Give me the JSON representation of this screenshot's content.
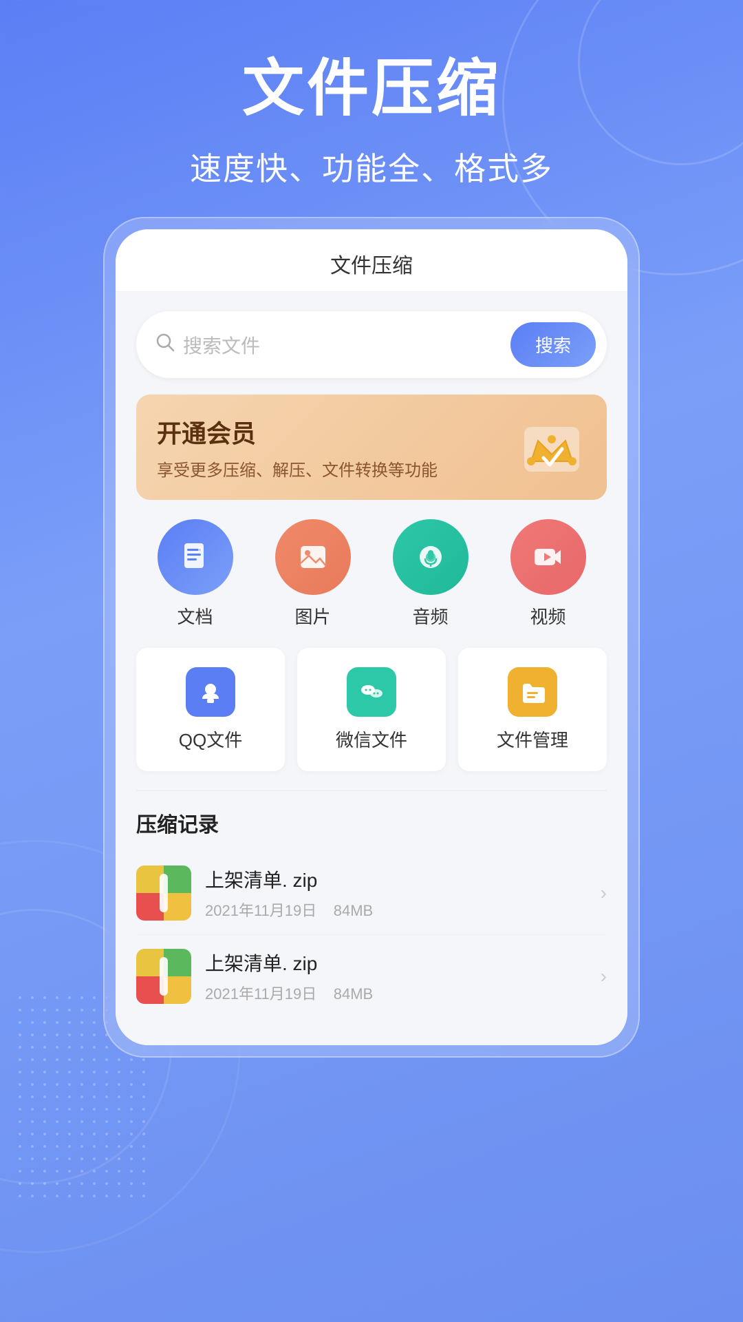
{
  "header": {
    "title": "文件压缩",
    "subtitle": "速度快、功能全、格式多"
  },
  "app": {
    "title": "文件压缩"
  },
  "search": {
    "placeholder": "搜索文件",
    "button_label": "搜索"
  },
  "vip": {
    "title": "开通会员",
    "desc": "享受更多压缩、解压、文件转换等功能"
  },
  "categories": [
    {
      "id": "doc",
      "label": "文档",
      "icon": "📄"
    },
    {
      "id": "img",
      "label": "图片",
      "icon": "🖼"
    },
    {
      "id": "audio",
      "label": "音频",
      "icon": "🎙"
    },
    {
      "id": "video",
      "label": "视频",
      "icon": "🎬"
    }
  ],
  "quick_access": [
    {
      "id": "qq",
      "label": "QQ文件",
      "icon": "🐧"
    },
    {
      "id": "wechat",
      "label": "微信文件",
      "icon": "💬"
    },
    {
      "id": "files",
      "label": "文件管理",
      "icon": "📁"
    }
  ],
  "records": {
    "section_title": "压缩记录",
    "items": [
      {
        "name": "上架清单. zip",
        "date": "2021年11月19日",
        "size": "84MB"
      },
      {
        "name": "上架清单. zip",
        "date": "2021年11月19日",
        "size": "84MB"
      }
    ]
  },
  "colors": {
    "primary": "#5b7ef5",
    "bg_gradient_start": "#5b7ef5",
    "bg_gradient_end": "#7b9ff8"
  }
}
